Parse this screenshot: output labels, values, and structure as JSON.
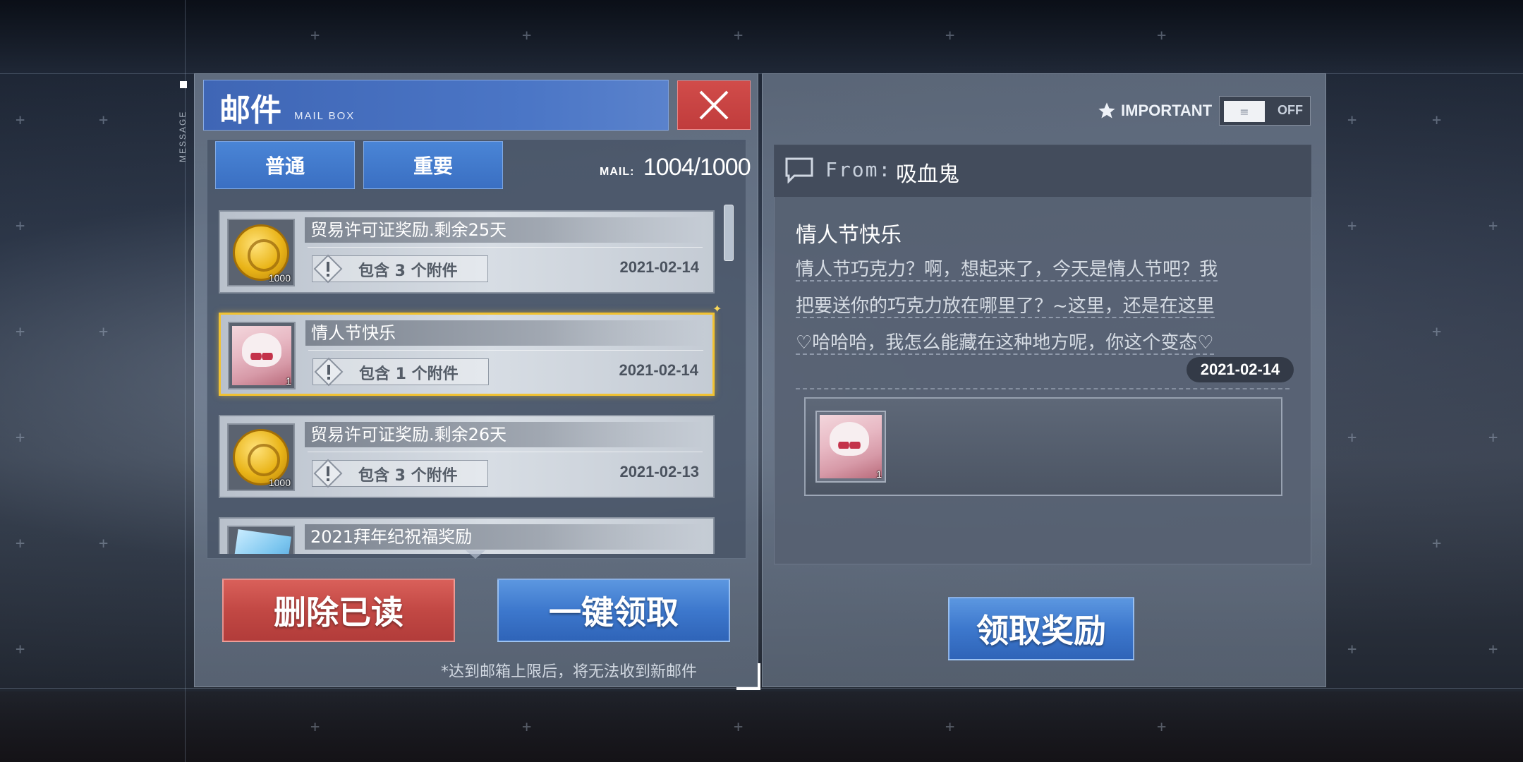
{
  "side_tag": "MESSAGE",
  "title": {
    "main": "邮件",
    "sub": "MAIL BOX"
  },
  "tabs": [
    {
      "label": "普通"
    },
    {
      "label": "重要"
    }
  ],
  "mail_count": {
    "label": "MAIL:",
    "value": "1004/1000"
  },
  "mail_list": [
    {
      "title": "贸易许可证奖励.剩余25天",
      "attachment_text": "包含 3 个附件",
      "date": "2021-02-14",
      "icon": "gold-coin-icon",
      "qty": "1000",
      "selected": false
    },
    {
      "title": "情人节快乐",
      "attachment_text": "包含 1 个附件",
      "date": "2021-02-14",
      "icon": "character-avatar-icon",
      "qty": "1",
      "selected": true
    },
    {
      "title": "贸易许可证奖励.剩余26天",
      "attachment_text": "包含 3 个附件",
      "date": "2021-02-13",
      "icon": "gold-coin-icon",
      "qty": "1000",
      "selected": false
    },
    {
      "title": "2021拜年纪祝福奖励",
      "icon": "ice-cube-icon",
      "selected": false
    }
  ],
  "buttons": {
    "delete_read": "删除已读",
    "claim_all": "一键领取",
    "claim_reward": "领取奖励"
  },
  "footnote": "*达到邮箱上限后，将无法收到新邮件",
  "important_toggle": {
    "label": "IMPORTANT",
    "state": "OFF"
  },
  "detail": {
    "from_label": "From:",
    "from_name": "吸血鬼",
    "title": "情人节快乐",
    "body_lines": [
      "情人节巧克力？啊，想起来了，今天是情人节吧？我",
      "把要送你的巧克力放在哪里了？~这里，还是在这里",
      "♡哈哈哈，我怎么能藏在这种地方呢，你这个变态♡"
    ],
    "date": "2021-02-14",
    "attachment_qty": "1"
  },
  "colors": {
    "accent_blue": "#3d78cd",
    "accent_red": "#c24844",
    "selected_border": "#f1c232"
  }
}
